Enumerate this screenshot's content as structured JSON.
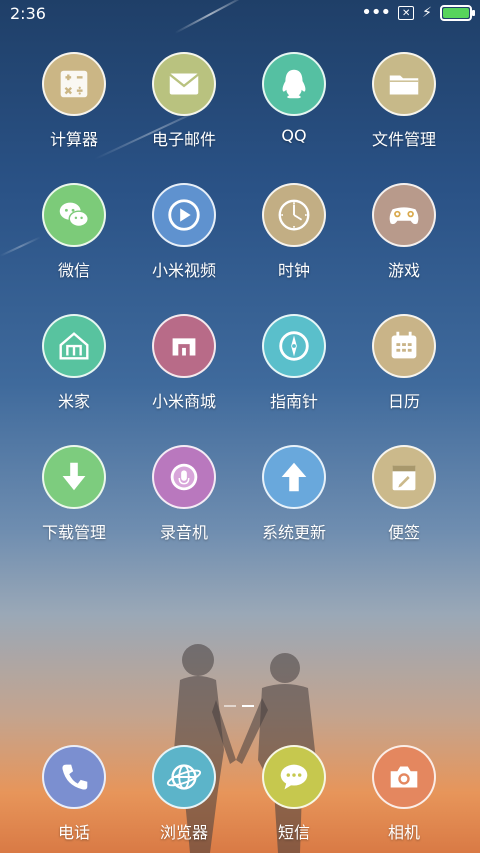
{
  "status": {
    "time": "2:36",
    "battery_level": 1.0,
    "battery_color": "#57d45c"
  },
  "apps": [
    {
      "label": "计算器",
      "color": "#cbb685",
      "icon": "calculator-icon"
    },
    {
      "label": "电子邮件",
      "color": "#b9c27f",
      "icon": "mail-icon"
    },
    {
      "label": "QQ",
      "color": "#55c0a2",
      "icon": "qq-penguin-icon"
    },
    {
      "label": "文件管理",
      "color": "#c7b989",
      "icon": "folder-icon"
    },
    {
      "label": "微信",
      "color": "#7ccb79",
      "icon": "wechat-icon"
    },
    {
      "label": "小米视频",
      "color": "#5f92cf",
      "icon": "play-icon"
    },
    {
      "label": "时钟",
      "color": "#c2ae84",
      "icon": "clock-icon"
    },
    {
      "label": "游戏",
      "color": "#b89a8b",
      "icon": "gamepad-icon"
    },
    {
      "label": "米家",
      "color": "#58c39f",
      "icon": "home-icon"
    },
    {
      "label": "小米商城",
      "color": "#b86b88",
      "icon": "mi-store-icon"
    },
    {
      "label": "指南针",
      "color": "#5abfcb",
      "icon": "compass-icon"
    },
    {
      "label": "日历",
      "color": "#c9b488",
      "icon": "calendar-icon"
    },
    {
      "label": "下载管理",
      "color": "#7dcc7e",
      "icon": "download-icon"
    },
    {
      "label": "录音机",
      "color": "#b978be",
      "icon": "recorder-icon"
    },
    {
      "label": "系统更新",
      "color": "#69a8dc",
      "icon": "update-arrow-icon"
    },
    {
      "label": "便签",
      "color": "#cbb98b",
      "icon": "notes-icon"
    }
  ],
  "dock": [
    {
      "label": "电话",
      "color": "#7b8fd0",
      "icon": "phone-icon"
    },
    {
      "label": "浏览器",
      "color": "#5cb4c9",
      "icon": "browser-globe-icon"
    },
    {
      "label": "短信",
      "color": "#c6c84e",
      "icon": "message-icon"
    },
    {
      "label": "相机",
      "color": "#e4875f",
      "icon": "camera-icon"
    }
  ],
  "pages": {
    "count": 2,
    "active": 2
  }
}
